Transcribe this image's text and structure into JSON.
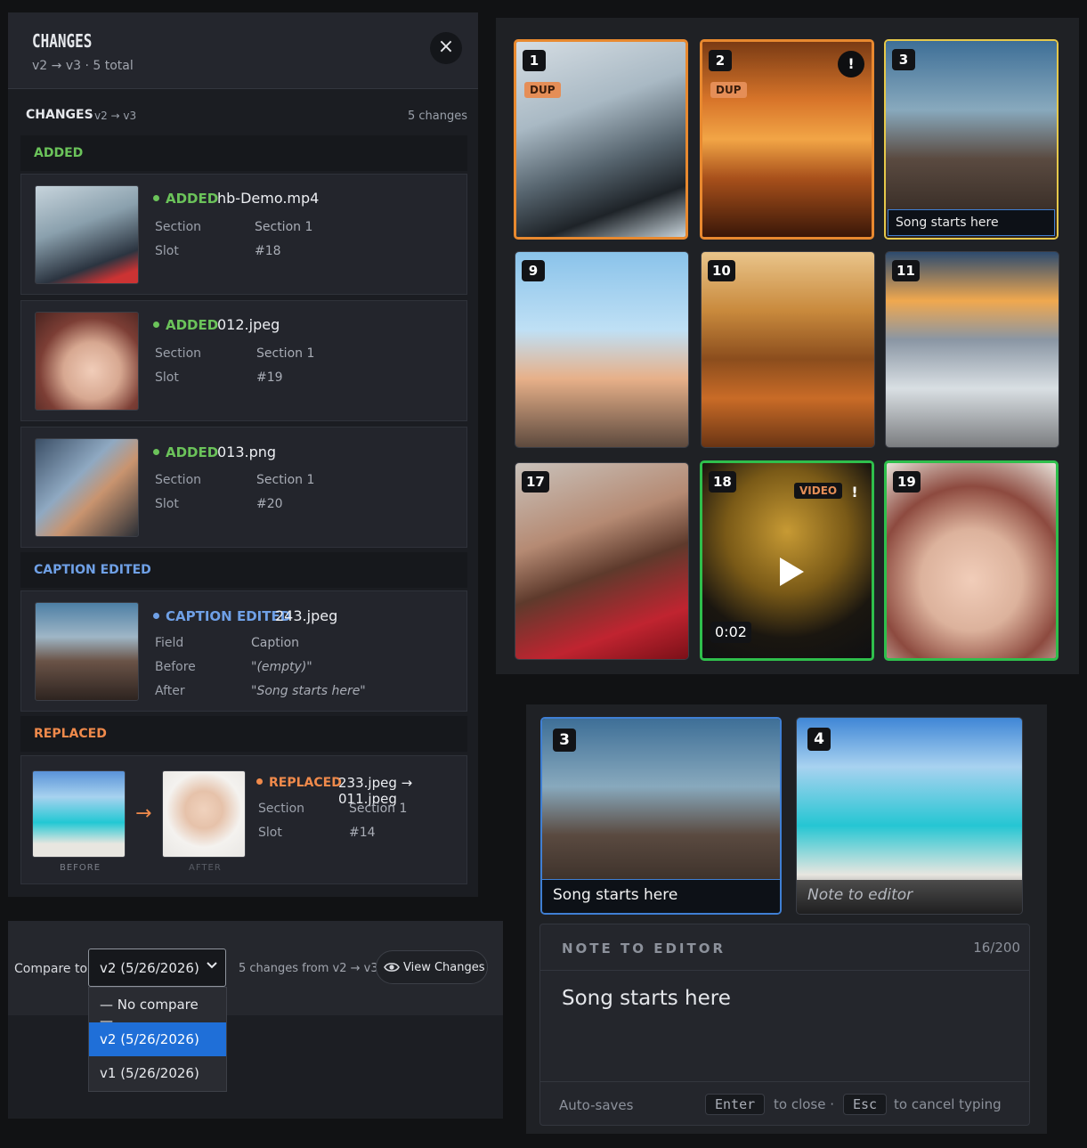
{
  "changes_panel": {
    "title": "CHANGES",
    "subtitle": "v2 → v3 · 5 total",
    "close_icon": "×",
    "bar_title": "CHANGES",
    "bar_version": "v2 → v3",
    "bar_count": "5 changes",
    "groups": {
      "added": "ADDED",
      "caption": "CAPTION EDITED",
      "replaced": "REPLACED"
    },
    "added_items": [
      {
        "tag": "ADDED",
        "file": "hb-Demo.mp4",
        "k1": "Section",
        "v1": "Section 1",
        "k2": "Slot",
        "v2": "#18"
      },
      {
        "tag": "ADDED",
        "file": "012.jpeg",
        "k1": "Section",
        "v1": "Section 1",
        "k2": "Slot",
        "v2": "#19"
      },
      {
        "tag": "ADDED",
        "file": "013.png",
        "k1": "Section",
        "v1": "Section 1",
        "k2": "Slot",
        "v2": "#20"
      }
    ],
    "caption_item": {
      "tag": "CAPTION EDITED",
      "file": "243.jpeg",
      "k1": "Field",
      "v1": "Caption",
      "k2": "Before",
      "v2": "\"(empty)\"",
      "k3": "After",
      "v3": "\"Song starts here\""
    },
    "replaced_item": {
      "tag": "REPLACED",
      "file": "233.jpeg → 011.jpeg",
      "k1": "Section",
      "v1": "Section 1",
      "k2": "Slot",
      "v2": "#14",
      "before_label": "BEFORE",
      "after_label": "AFTER",
      "arrow": "→"
    }
  },
  "compare": {
    "label": "Compare to:",
    "selected": "v2 (5/26/2026)",
    "info": "5 changes from v2 → v3",
    "view_button": "View Changes",
    "options": [
      "— No compare —",
      "v2 (5/26/2026)",
      "v1 (5/26/2026)"
    ]
  },
  "grid": {
    "tiles": [
      {
        "num": "1",
        "badge": "DUP"
      },
      {
        "num": "2",
        "badge": "DUP",
        "warn": "!"
      },
      {
        "num": "3",
        "caption": "Song starts here"
      },
      {
        "num": "9"
      },
      {
        "num": "10"
      },
      {
        "num": "11"
      },
      {
        "num": "17"
      },
      {
        "num": "18",
        "badge": "VIDEO",
        "warn": "!",
        "duration": "0:02"
      },
      {
        "num": "19"
      }
    ]
  },
  "editor": {
    "card_a": {
      "num": "3",
      "caption": "Song starts here"
    },
    "card_b": {
      "num": "4",
      "caption": "Note to editor"
    },
    "note_title": "NOTE TO EDITOR",
    "note_count": "16/200",
    "note_text": "Song starts here",
    "autosave": "Auto-saves",
    "key_enter": "Enter",
    "hint_close": "to close ·",
    "key_esc": "Esc",
    "hint_cancel": "to cancel typing"
  },
  "colors": {
    "added": "#6bc35a",
    "caption": "#6fa0e6",
    "replaced": "#f08a4b",
    "dup_border": "#e8892f",
    "selected_border": "#e6c84a",
    "new_border": "#2fbf4c",
    "dropdown_selected": "#1f6fd8"
  }
}
